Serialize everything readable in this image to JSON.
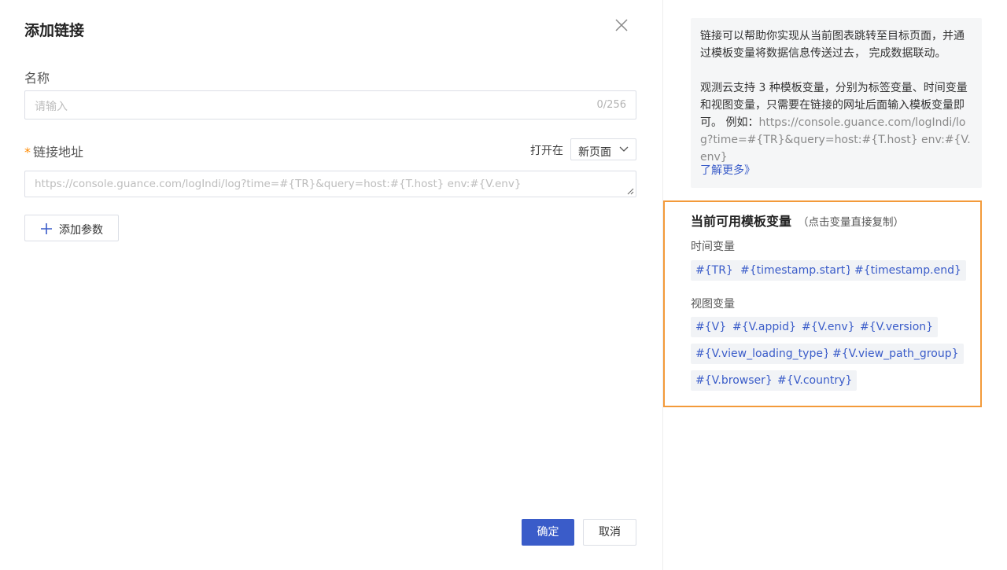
{
  "dialog": {
    "title": "添加链接",
    "name_label": "名称",
    "name_placeholder": "请输入",
    "name_counter": "0/256",
    "url_required_mark": "*",
    "url_label": "链接地址",
    "open_in_label": "打开在",
    "open_in_value": "新页面",
    "url_placeholder": "https://console.guance.com/logIndi/log?time=#{TR}&query=host:#{T.host} env:#{V.env}",
    "add_param_label": "添加参数",
    "confirm_label": "确定",
    "cancel_label": "取消"
  },
  "help": {
    "p1": "链接可以帮助你实现从当前图表跳转至目标页面，并通过模板变量将数据信息传送过去， 完成数据联动。",
    "p2_text": "观测云支持 3 种模板变量，分别为标签变量、时间变量和视图变量，只需要在链接的网址后面输入模板变量即可。 例如：",
    "p2_url": "https://console.guance.com/logIndi/log?time=#{TR}&query=host:#{T.host} env:#{V.env}",
    "learn_more": "了解更多》"
  },
  "variables": {
    "heading": "当前可用模板变量",
    "hint": "（点击变量直接复制）",
    "time_label": "时间变量",
    "time_vars": [
      "#{TR}",
      "#{timestamp.start}",
      "#{timestamp.end}"
    ],
    "view_label": "视图变量",
    "view_vars": [
      "#{V}",
      "#{V.appid}",
      "#{V.env}",
      "#{V.version}",
      "#{V.view_loading_type}",
      "#{V.view_path_group}",
      "#{V.browser}",
      "#{V.country}"
    ]
  },
  "colors": {
    "primary": "#3a5cc9",
    "highlight_border": "#f39a3a",
    "required": "#ff8a00"
  }
}
